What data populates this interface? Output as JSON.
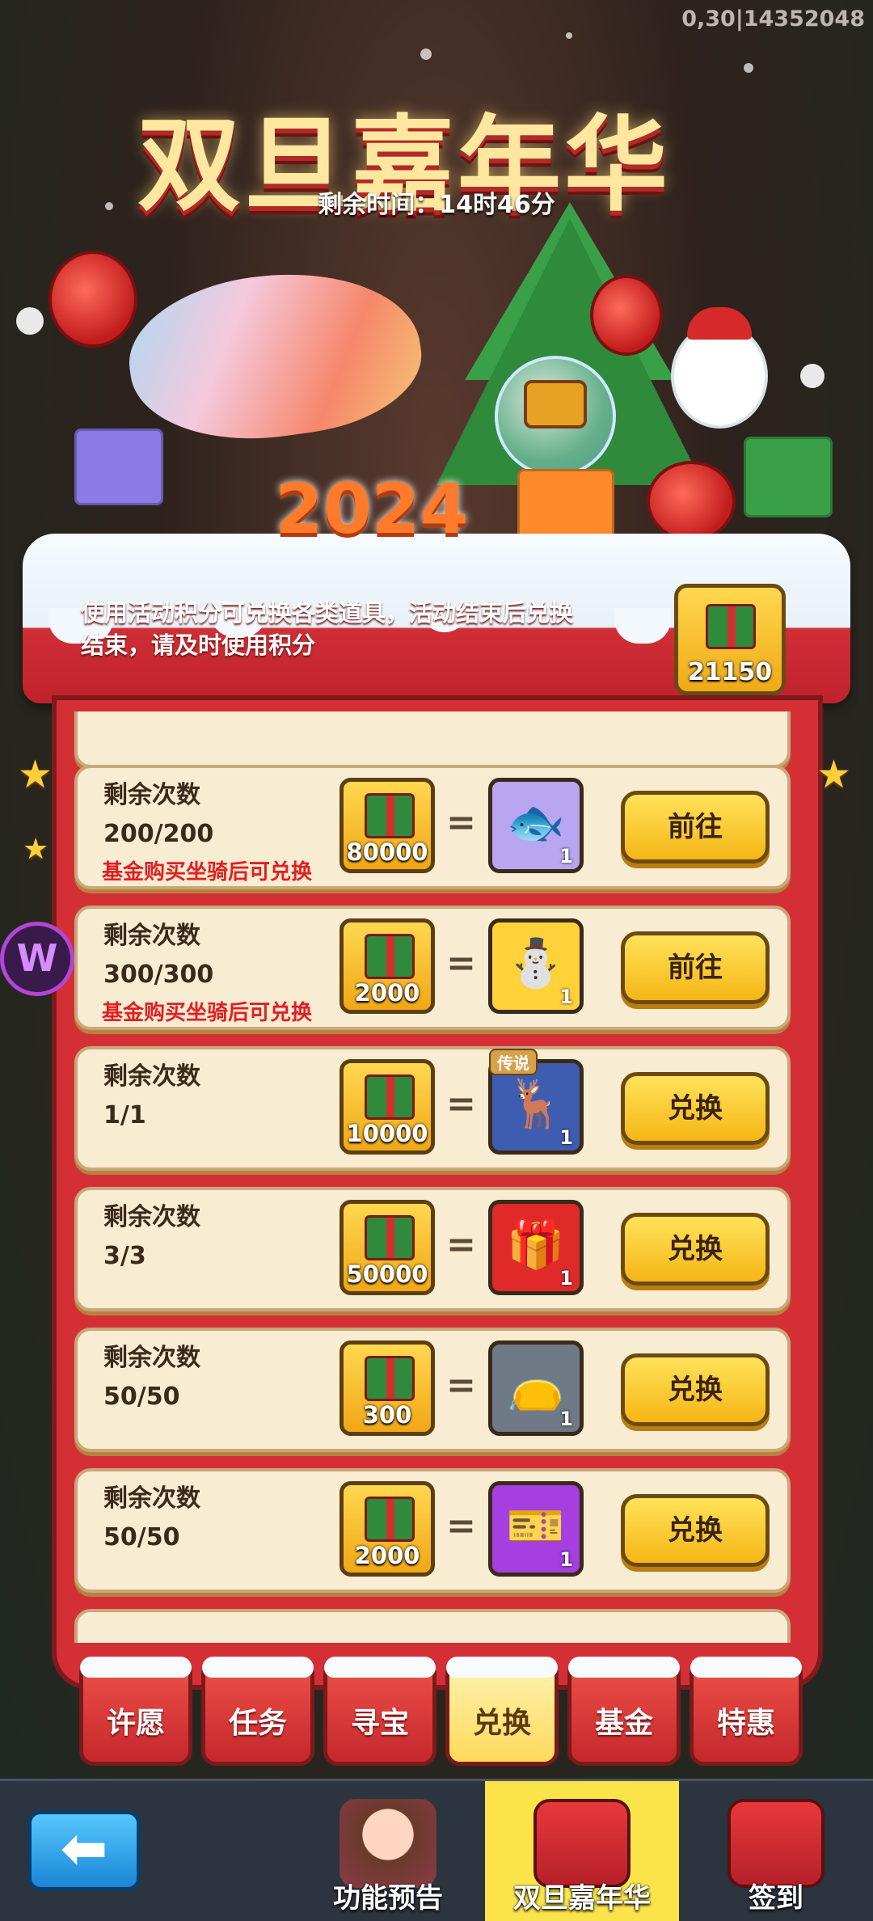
{
  "version_text": "0,30|14352048",
  "event": {
    "title": "双旦嘉年华",
    "remaining_time": "剩余时间：14时46分",
    "year": "2024",
    "info": "使用活动积分可兑换各类道具，活动结束后兑换结束，请及时使用积分",
    "points": "21150"
  },
  "rows": [
    {
      "count_label": "剩余次数",
      "count": "200/200",
      "note": "基金购买坐骑后可兑换",
      "cost": "80000",
      "reward_icon": "fish-mount-icon",
      "reward_glyph": "🐟",
      "reward_bg": "#b8a6f0",
      "reward_qty": "1",
      "legend": "",
      "button": "前往"
    },
    {
      "count_label": "剩余次数",
      "count": "300/300",
      "note": "基金购买坐骑后可兑换",
      "cost": "2000",
      "reward_icon": "snowman-mount-icon",
      "reward_glyph": "⛄",
      "reward_bg": "#ffd23a",
      "reward_qty": "1",
      "legend": "",
      "button": "前往"
    },
    {
      "count_label": "剩余次数",
      "count": "1/1",
      "note": "",
      "cost": "10000",
      "reward_icon": "reindeer-sleigh-icon",
      "reward_glyph": "🦌",
      "reward_bg": "#3f5db0",
      "reward_qty": "1",
      "legend": "传说",
      "button": "兑换"
    },
    {
      "count_label": "剩余次数",
      "count": "3/3",
      "note": "",
      "cost": "50000",
      "reward_icon": "gift-box-icon",
      "reward_glyph": "🎁",
      "reward_bg": "#e02a2a",
      "reward_qty": "1",
      "legend": "",
      "button": "兑换"
    },
    {
      "count_label": "剩余次数",
      "count": "50/50",
      "note": "",
      "cost": "300",
      "reward_icon": "lucky-bag-icon",
      "reward_glyph": "👝",
      "reward_bg": "#6f7a86",
      "reward_qty": "1",
      "legend": "",
      "button": "兑换"
    },
    {
      "count_label": "剩余次数",
      "count": "50/50",
      "note": "",
      "cost": "2000",
      "reward_icon": "ticket-pack-icon",
      "reward_glyph": "🎫",
      "reward_bg": "#a63ee0",
      "reward_qty": "1",
      "legend": "",
      "button": "兑换"
    }
  ],
  "tabs": [
    "许愿",
    "任务",
    "寻宝",
    "兑换",
    "基金",
    "特惠"
  ],
  "active_tab": "兑换",
  "bottom_nav": [
    {
      "label": "功能预告",
      "icon": "preview-girl-icon"
    },
    {
      "label": "双旦嘉年华",
      "icon": "carnival-2024-icon",
      "active": true
    },
    {
      "label": "签到",
      "icon": "signin-2024-icon"
    }
  ],
  "colors": {
    "panel_red": "#d52f36",
    "button_yellow": "#f5b616",
    "row_bg": "#f8ecd2",
    "note_red": "#e21f23",
    "active_bottom": "#fbe44a"
  }
}
